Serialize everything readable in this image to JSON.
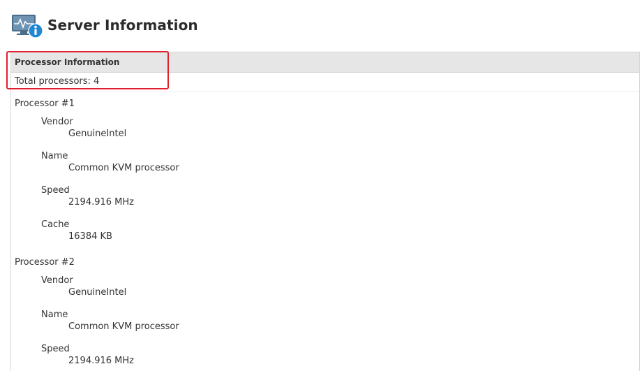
{
  "header": {
    "title": "Server Information",
    "icon": "server-monitor-info-icon"
  },
  "panel": {
    "header": "Processor Information",
    "total": "Total processors: 4"
  },
  "processors": [
    {
      "title": "Processor #1",
      "fields": [
        {
          "label": "Vendor",
          "value": "GenuineIntel"
        },
        {
          "label": "Name",
          "value": "Common KVM processor"
        },
        {
          "label": "Speed",
          "value": "2194.916 MHz"
        },
        {
          "label": "Cache",
          "value": "16384 KB"
        }
      ]
    },
    {
      "title": "Processor #2",
      "fields": [
        {
          "label": "Vendor",
          "value": "GenuineIntel"
        },
        {
          "label": "Name",
          "value": "Common KVM processor"
        },
        {
          "label": "Speed",
          "value": "2194.916 MHz"
        }
      ]
    }
  ],
  "colors": {
    "highlight": "#e0202e",
    "header_bg": "#e6e6e6",
    "icon_blue": "#1e88d4"
  }
}
